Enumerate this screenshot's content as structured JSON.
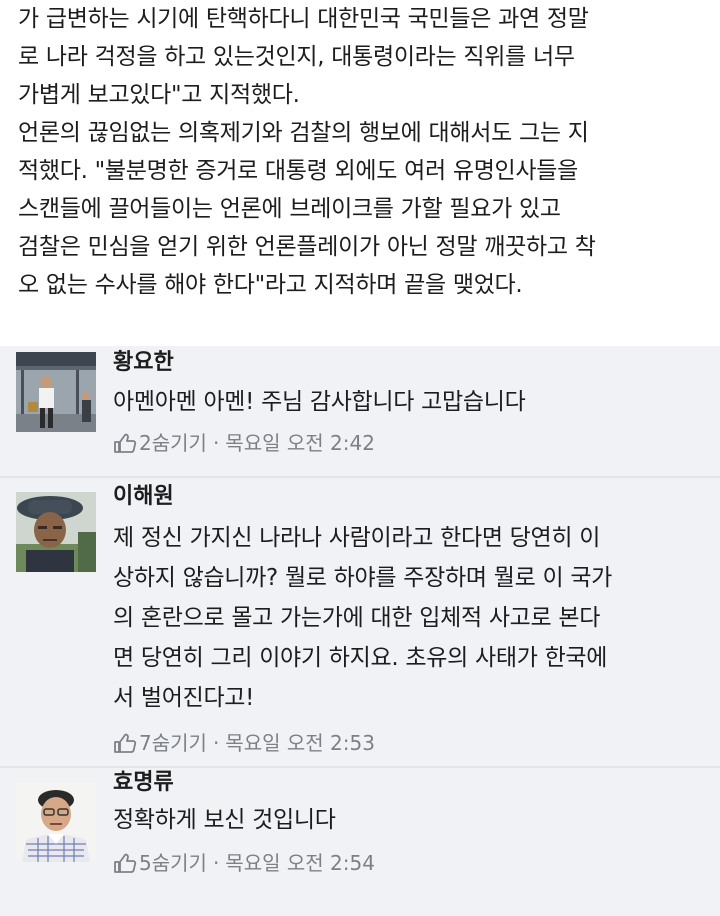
{
  "article": {
    "lines": [
      "가 급변하는 시기에 탄핵하다니 대한민국 국민들은 과연 정말",
      "로 나라 걱정을 하고 있는것인지, 대통령이라는 직위를 너무",
      "가볍게 보고있다\"고 지적했다.",
      "언론의 끊임없는 의혹제기와 검찰의 행보에 대해서도 그는 지",
      "적했다. \"불분명한 증거로 대통령 외에도 여러 유명인사들을",
      "스캔들에 끌어들이는 언론에 브레이크를 가할 필요가 있고",
      "검찰은 민심을 얻기 위한 언론플레이가 아닌 정말 깨끗하고 착",
      "오 없는 수사를 해야 한다\"라고 지적하며 끝을 맺었다."
    ]
  },
  "comments": [
    {
      "name": "황요한",
      "lines": [
        "아멘아멘 아멘! 주님 감사합니다 고맙습니다"
      ],
      "likes": "2",
      "hide_label": "숨기기",
      "time": "목요일 오전 2:42"
    },
    {
      "name": "이해원",
      "lines": [
        "제 정신 가지신 나라나 사람이라고 한다면 당연히 이",
        "상하지 않습니까? 뭘로 하야를 주장하며 뭘로 이 국가",
        "의 혼란으로 몰고 가는가에 대한 입체적 사고로 본다",
        "면 당연히 그리 이야기 하지요. 초유의 사태가 한국에",
        "서 벌어진다고!"
      ],
      "likes": "7",
      "hide_label": "숨기기",
      "time": "목요일 오전 2:53"
    },
    {
      "name": "효명류",
      "lines": [
        "정확하게 보신 것입니다"
      ],
      "likes": "5",
      "hide_label": "숨기기",
      "time": "목요일 오전 2:54"
    }
  ],
  "meta_separator": "·",
  "icons": {
    "like": "thumbs-up-icon"
  },
  "colors": {
    "meta_text": "#7d8187",
    "comments_bg": "#f0f2f5"
  }
}
